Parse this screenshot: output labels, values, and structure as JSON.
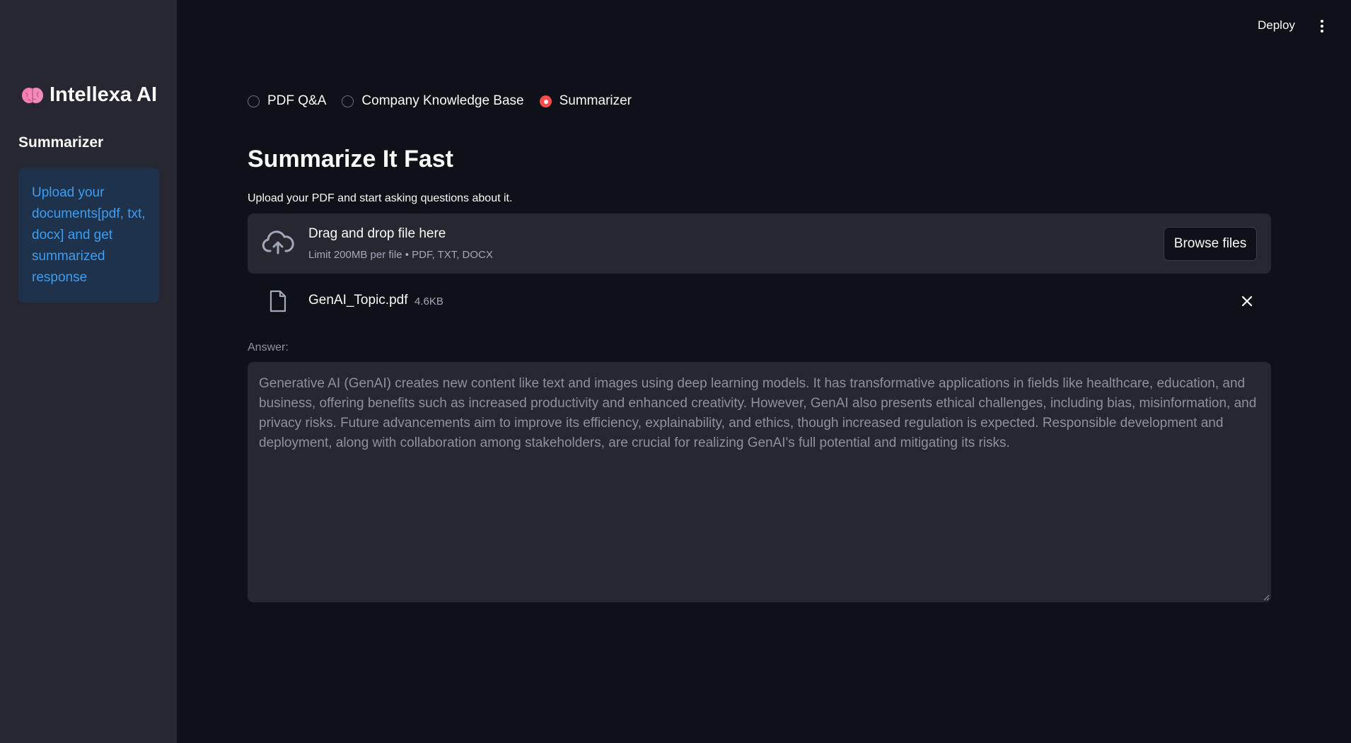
{
  "sidebar": {
    "brand": "Intellexa AI",
    "brand_icon": "brain-icon",
    "heading": "Summarizer",
    "info_text": "Upload your documents[pdf, txt, docx] and get summarized response"
  },
  "topbar": {
    "deploy_label": "Deploy",
    "menu_icon": "kebab-icon"
  },
  "mode_radio": {
    "options": [
      "PDF Q&A",
      "Company Knowledge Base",
      "Summarizer"
    ],
    "selected": "Summarizer"
  },
  "main": {
    "title": "Summarize It Fast",
    "uploader_caption": "Upload your PDF and start asking questions about it.",
    "dropzone": {
      "title": "Drag and drop file here",
      "subtitle": "Limit 200MB per file • PDF, TXT, DOCX",
      "browse_label": "Browse files"
    },
    "uploaded_file": {
      "name": "GenAI_Topic.pdf",
      "size": "4.6KB"
    },
    "answer_label": "Answer:",
    "answer_text": "Generative AI (GenAI) creates new content like text and images using deep learning models. It has transformative applications in fields like healthcare, education, and business, offering benefits such as increased productivity and enhanced creativity. However, GenAI also presents ethical challenges, including bias, misinformation, and privacy risks. Future advancements aim to improve its efficiency, explainability, and ethics, though increased regulation is expected. Responsible development and deployment, along with collaboration among stakeholders, are crucial for realizing GenAI's full potential and mitigating its risks."
  },
  "colors": {
    "background": "#0e1117",
    "sidebar": "#262730",
    "accent": "#ff4b4b",
    "info_bg": "#1e324b",
    "info_text": "#3d9df3"
  }
}
